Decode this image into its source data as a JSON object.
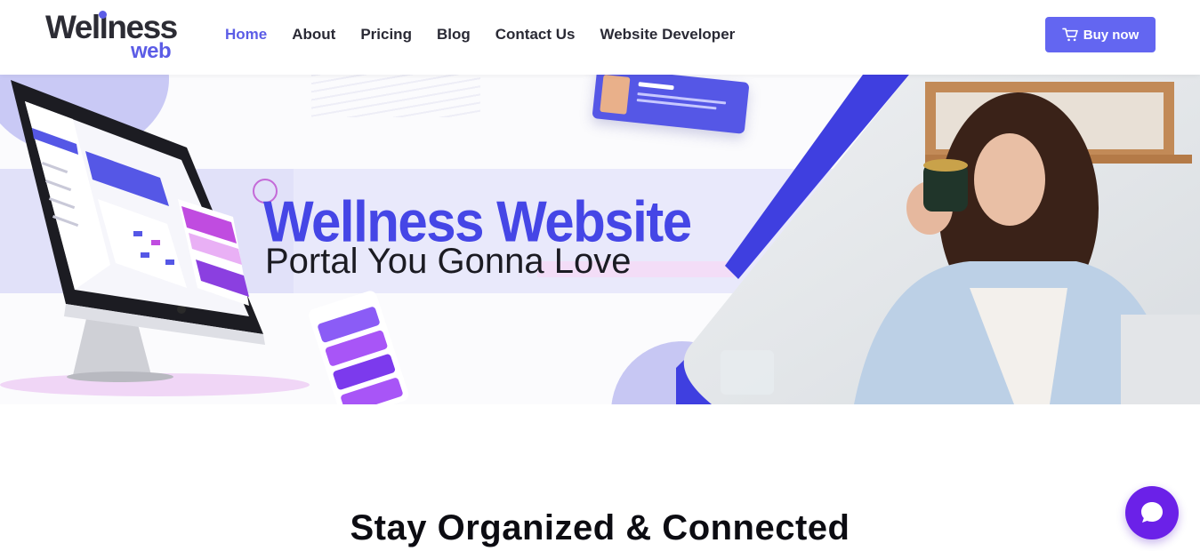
{
  "header": {
    "logo_top": "Wellness",
    "logo_bottom": "web",
    "nav": [
      {
        "label": "Home",
        "active": true
      },
      {
        "label": "About",
        "active": false
      },
      {
        "label": "Pricing",
        "active": false
      },
      {
        "label": "Blog",
        "active": false
      },
      {
        "label": "Contact Us",
        "active": false
      },
      {
        "label": "Website Developer",
        "active": false
      }
    ],
    "buy_label": "Buy now"
  },
  "hero": {
    "headline": "Wellness Website",
    "subheadline": "Portal You Gonna Love"
  },
  "section": {
    "title": "Stay Organized & Connected"
  },
  "colors": {
    "accent": "#5b5ce6",
    "button": "#6366f1",
    "chat": "#6b21e8"
  }
}
